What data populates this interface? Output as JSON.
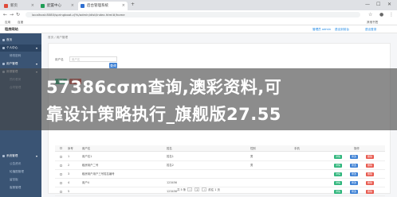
{
  "tabs": [
    {
      "label": "新页",
      "color": "#e04b3a"
    },
    {
      "label": "配置中心",
      "color": "#1f9d55"
    },
    {
      "label": "后台管理系统",
      "color": "#2f6fd1"
    }
  ],
  "window": {
    "minimize": "—",
    "maximize": "☐",
    "close": "✕"
  },
  "address": {
    "url": "localhost:8080/springboot-cJYs/admin/dist/index.html#/home"
  },
  "bookmarks": [
    "应用",
    "百度",
    "其他书签"
  ],
  "header": {
    "title": "租房网站",
    "links": [
      "管理员 admin",
      "退出到前台",
      "退出登录"
    ]
  },
  "sidebar": {
    "items": [
      {
        "label": "首页",
        "kind": "group"
      },
      {
        "label": "个人中心",
        "kind": "group",
        "active": true
      },
      {
        "label": "修改密码",
        "kind": "sub"
      },
      {
        "label": "用户管理",
        "kind": "group"
      },
      {
        "label": "房源管理",
        "kind": "group"
      },
      {
        "label": "预约看房",
        "kind": "sub"
      },
      {
        "label": "合同管理",
        "kind": "sub"
      },
      {
        "label": "系统管理",
        "kind": "group"
      },
      {
        "label": "公告资讯",
        "kind": "sub"
      },
      {
        "label": "轮播图管理",
        "kind": "sub"
      },
      {
        "label": "留言板",
        "kind": "sub"
      },
      {
        "label": "客服管理",
        "kind": "sub"
      },
      {
        "label": "收藏管理",
        "kind": "group"
      }
    ]
  },
  "breadcrumb": "首页 / 用户管理",
  "filter": {
    "label": "用户名",
    "placeholder": "用户名",
    "search_label": "查询"
  },
  "toolbar": {
    "add": "新增",
    "delete": "删除"
  },
  "table": {
    "headers": [
      "序号",
      "用户名",
      "姓名",
      "性别",
      "手机",
      "操作"
    ],
    "rows": [
      {
        "no": "1",
        "username": "用户名1",
        "name": "姓名1",
        "gender": "男",
        "phone": ""
      },
      {
        "no": "2",
        "username": "租房用户二号",
        "name": "姓名2",
        "gender": "男",
        "phone": ""
      },
      {
        "no": "3",
        "username": "租房用户用户三号姓名编号",
        "name": "",
        "gender": "",
        "phone": ""
      },
      {
        "no": "4",
        "username": "用户4",
        "name": "123456",
        "gender": "",
        "phone": ""
      },
      {
        "no": "5",
        "username": "",
        "name": "123456",
        "gender": "",
        "phone": ""
      }
    ],
    "actions": [
      "详情",
      "修改",
      "删除"
    ]
  },
  "pager": {
    "total": "共 5 条",
    "page": "1",
    "goto": "前往 1 页"
  },
  "banner": {
    "line1": "57386cσm查询,澳彩资料,可",
    "line2": "靠设计策略执行_旗舰版27.55"
  },
  "colors": {
    "sidebar": "#3a5474",
    "primary": "#3b7fd4",
    "danger": "#e85a4f",
    "success": "#2fb67c",
    "warning": "#f0a93a"
  }
}
